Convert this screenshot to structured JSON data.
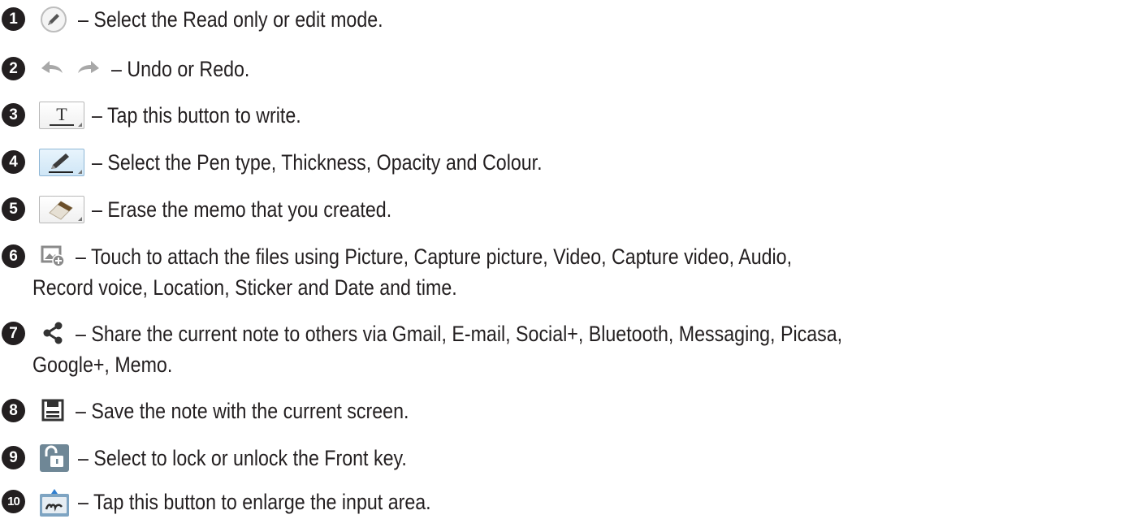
{
  "items": [
    {
      "number": "1",
      "icon": "pen-circle-icon",
      "text": "– Select the Read only or edit mode."
    },
    {
      "number": "2",
      "icon": "undo-redo-icon",
      "text": "– Undo or Redo."
    },
    {
      "number": "3",
      "icon": "text-button-icon",
      "icon_glyph": "T",
      "text": "– Tap this button to write."
    },
    {
      "number": "4",
      "icon": "pen-button-icon",
      "text": "– Select the Pen type, Thickness, Opacity and Colour."
    },
    {
      "number": "5",
      "icon": "eraser-button-icon",
      "text": "– Erase the memo that you created."
    },
    {
      "number": "6",
      "icon": "attach-picture-icon",
      "text": "– Touch to attach the files using Picture, Capture picture, Video, Capture video, Audio,",
      "continuation": "Record voice, Location, Sticker and Date and time."
    },
    {
      "number": "7",
      "icon": "share-icon",
      "text": "– Share the current note to others via Gmail, E-mail, Social+, Bluetooth, Messaging, Picasa,",
      "continuation": "Google+, Memo."
    },
    {
      "number": "8",
      "icon": "save-icon",
      "text": "– Save the note with the current screen."
    },
    {
      "number": "9",
      "icon": "unlock-icon",
      "text": "– Select to lock or unlock the Front key."
    },
    {
      "number": "10",
      "icon": "enlarge-input-icon",
      "text": "– Tap this button to enlarge the input area."
    }
  ],
  "colors": {
    "text": "#231f20",
    "icon_gray": "#9a9a9a",
    "icon_blue": "#3a87c8"
  }
}
